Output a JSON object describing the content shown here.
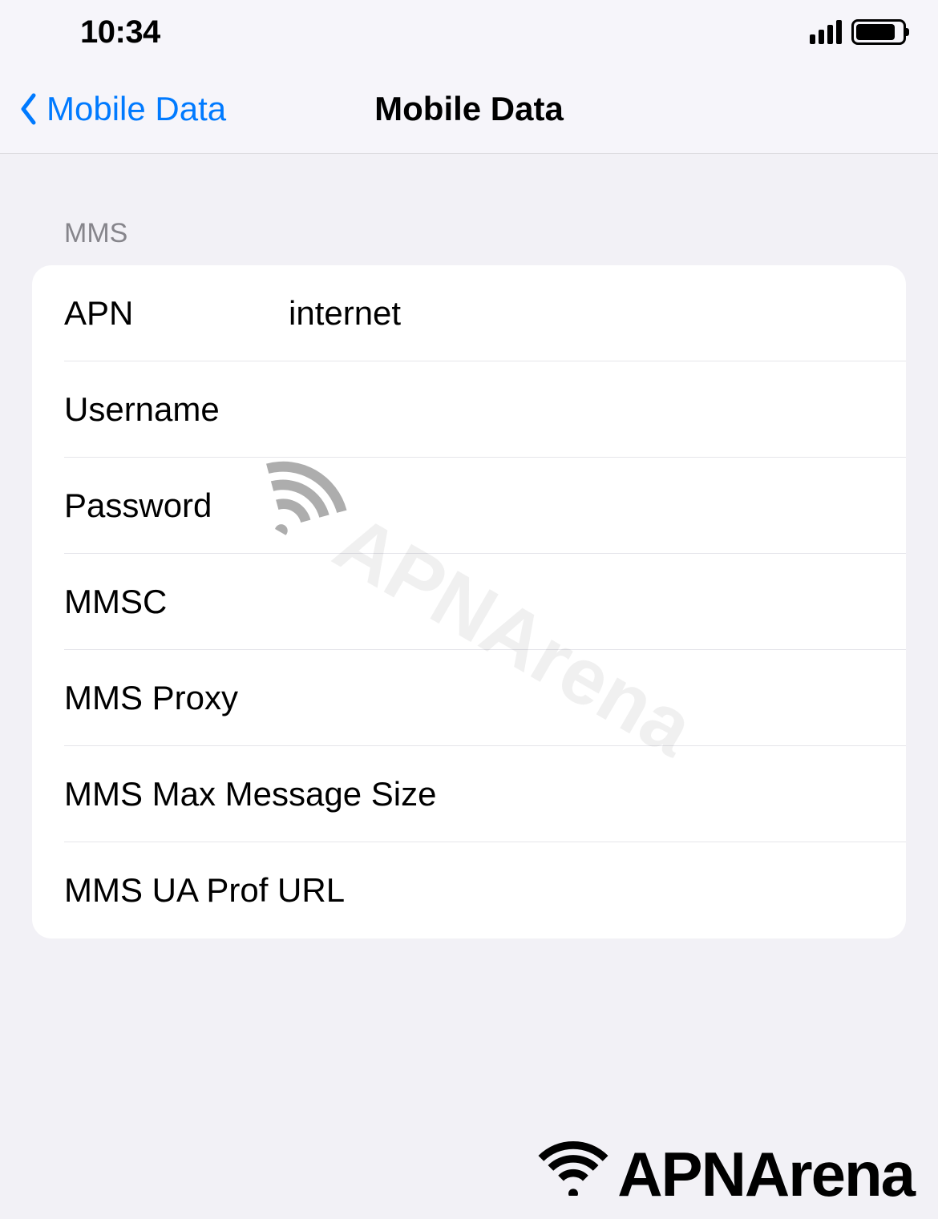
{
  "status": {
    "time": "10:34"
  },
  "nav": {
    "back_label": "Mobile Data",
    "title": "Mobile Data"
  },
  "section": {
    "header": "MMS"
  },
  "fields": {
    "apn": {
      "label": "APN",
      "value": "internet"
    },
    "username": {
      "label": "Username",
      "value": ""
    },
    "password": {
      "label": "Password",
      "value": ""
    },
    "mmsc": {
      "label": "MMSC",
      "value": ""
    },
    "mms_proxy": {
      "label": "MMS Proxy",
      "value": ""
    },
    "mms_max_size": {
      "label": "MMS Max Message Size",
      "value": ""
    },
    "mms_ua_prof": {
      "label": "MMS UA Prof URL",
      "value": ""
    }
  },
  "branding": {
    "watermark": "APNArena",
    "logo": "APNArena"
  }
}
